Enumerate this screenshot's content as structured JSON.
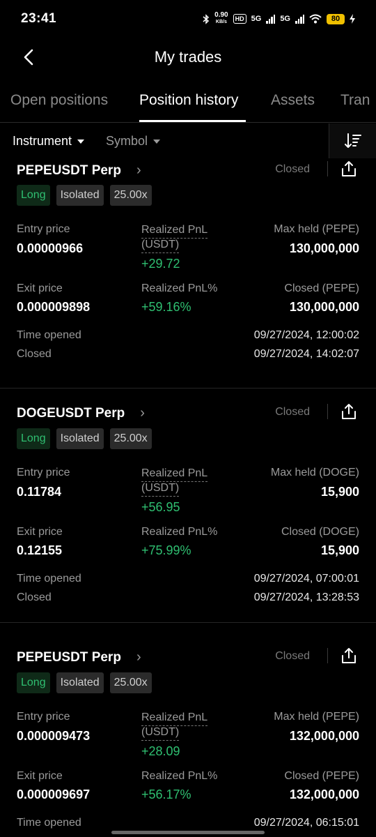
{
  "status_bar": {
    "time": "23:41",
    "net_speed": "0.90",
    "net_unit": "KB/s",
    "hd": "HD",
    "sig1": "5G",
    "sig2": "5G",
    "battery": "80"
  },
  "header": {
    "title": "My trades"
  },
  "tabs": [
    {
      "label": "Open positions",
      "active": false
    },
    {
      "label": "Position history",
      "active": true
    },
    {
      "label": "Assets",
      "active": false
    },
    {
      "label": "Tran",
      "active": false
    }
  ],
  "filters": {
    "instrument": "Instrument",
    "symbol": "Symbol"
  },
  "labels": {
    "entry_price": "Entry price",
    "exit_price": "Exit price",
    "realized_pnl": "Realized PnL",
    "realized_pnl_unit": "(USDT)",
    "realized_pnl_pct": "Realized PnL%",
    "time_opened": "Time opened",
    "closed": "Closed"
  },
  "positions": [
    {
      "symbol": "PEPEUSDT Perp",
      "status": "Closed",
      "side": "Long",
      "margin": "Isolated",
      "leverage": "25.00x",
      "entry_price": "0.00000966",
      "exit_price": "0.000009898",
      "realized_pnl": "+29.72",
      "realized_pnl_pct": "+59.16%",
      "max_held_label": "Max held (PEPE)",
      "max_held": "130,000,000",
      "closed_label": "Closed (PEPE)",
      "closed_amount": "130,000,000",
      "time_opened": "09/27/2024, 12:00:02",
      "time_closed": "09/27/2024, 14:02:07"
    },
    {
      "symbol": "DOGEUSDT Perp",
      "status": "Closed",
      "side": "Long",
      "margin": "Isolated",
      "leverage": "25.00x",
      "entry_price": "0.11784",
      "exit_price": "0.12155",
      "realized_pnl": "+56.95",
      "realized_pnl_pct": "+75.99%",
      "max_held_label": "Max held (DOGE)",
      "max_held": "15,900",
      "closed_label": "Closed (DOGE)",
      "closed_amount": "15,900",
      "time_opened": "09/27/2024, 07:00:01",
      "time_closed": "09/27/2024, 13:28:53"
    },
    {
      "symbol": "PEPEUSDT Perp",
      "status": "Closed",
      "side": "Long",
      "margin": "Isolated",
      "leverage": "25.00x",
      "entry_price": "0.000009473",
      "exit_price": "0.000009697",
      "realized_pnl": "+28.09",
      "realized_pnl_pct": "+56.17%",
      "max_held_label": "Max held (PEPE)",
      "max_held": "132,000,000",
      "closed_label": "Closed (PEPE)",
      "closed_amount": "132,000,000",
      "time_opened": "09/27/2024, 06:15:01"
    }
  ]
}
